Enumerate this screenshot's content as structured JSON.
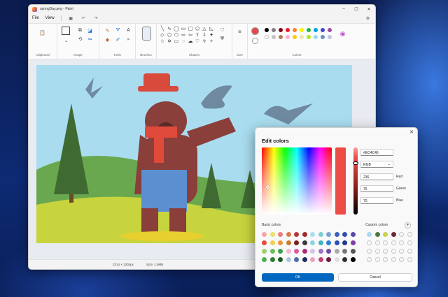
{
  "window": {
    "title": "springDay.png - Paint"
  },
  "menu": {
    "file": "File",
    "view": "View"
  },
  "ribbon": {
    "groups": [
      "Clipboard",
      "Image",
      "Tools",
      "Brushes",
      "Shapes",
      "Size",
      "Colors"
    ]
  },
  "colors": {
    "primary": "#e8474a",
    "secondary": "#ffffff",
    "palette": [
      "#000000",
      "#7f7f7f",
      "#880015",
      "#ed1c24",
      "#ff7f27",
      "#fff200",
      "#22b14c",
      "#00a2e8",
      "#3f48cc",
      "#a349a4",
      "#ffffff",
      "#c3c3c3",
      "#b97a57",
      "#ffaec9",
      "#ffc90e",
      "#efe4b0",
      "#b5e61d",
      "#99d9ea",
      "#7092be",
      "#c8bfe7"
    ]
  },
  "status": {
    "dimensions": "2314 × 1303px",
    "size": "Size: 1.9MB"
  },
  "dialog": {
    "title": "Edit colors",
    "hex": "#EC4C46",
    "mode": "RGB",
    "red_value": "236",
    "red_label": "Red",
    "green_value": "76",
    "green_label": "Green",
    "blue_value": "70",
    "blue_label": "Blue",
    "current_color": "#ec4c46",
    "basic_label": "Basic colors",
    "custom_label": "Custom colors",
    "basic_colors": [
      "#f4a6a6",
      "#e8e36a",
      "#ea7e7e",
      "#d97b4e",
      "#b33a3a",
      "#9f2d2d",
      "#a6e0f2",
      "#7ccfd1",
      "#79a0d6",
      "#3d62bd",
      "#3450a8",
      "#5a4aa8",
      "#e74c3c",
      "#f1d14b",
      "#f0943a",
      "#c97c2d",
      "#7a1f1f",
      "#3a3a3a",
      "#8fd3e8",
      "#41b4c6",
      "#2e7fd6",
      "#2a4fb3",
      "#1e3a8a",
      "#7d3ca8",
      "#9bd36a",
      "#6abf5a",
      "#3da04b",
      "#f2b8d6",
      "#e05aa0",
      "#b02a78",
      "#d6c2ea",
      "#9a74c8",
      "#6f4aa8",
      "#aaaaaa",
      "#777777",
      "#555555",
      "#4caf50",
      "#2e7d32",
      "#1b5e20",
      "#b0c4de",
      "#4a6fa5",
      "#1a2f5a",
      "#f0a0c0",
      "#c04070",
      "#6a1a40",
      "#e0e0e0",
      "#303030",
      "#000000"
    ],
    "custom_colors": [
      "#a8d8f0",
      "#4a7a3a",
      "#c8d44a",
      "#6a2a3a"
    ],
    "ok": "OK",
    "cancel": "Cancel"
  }
}
